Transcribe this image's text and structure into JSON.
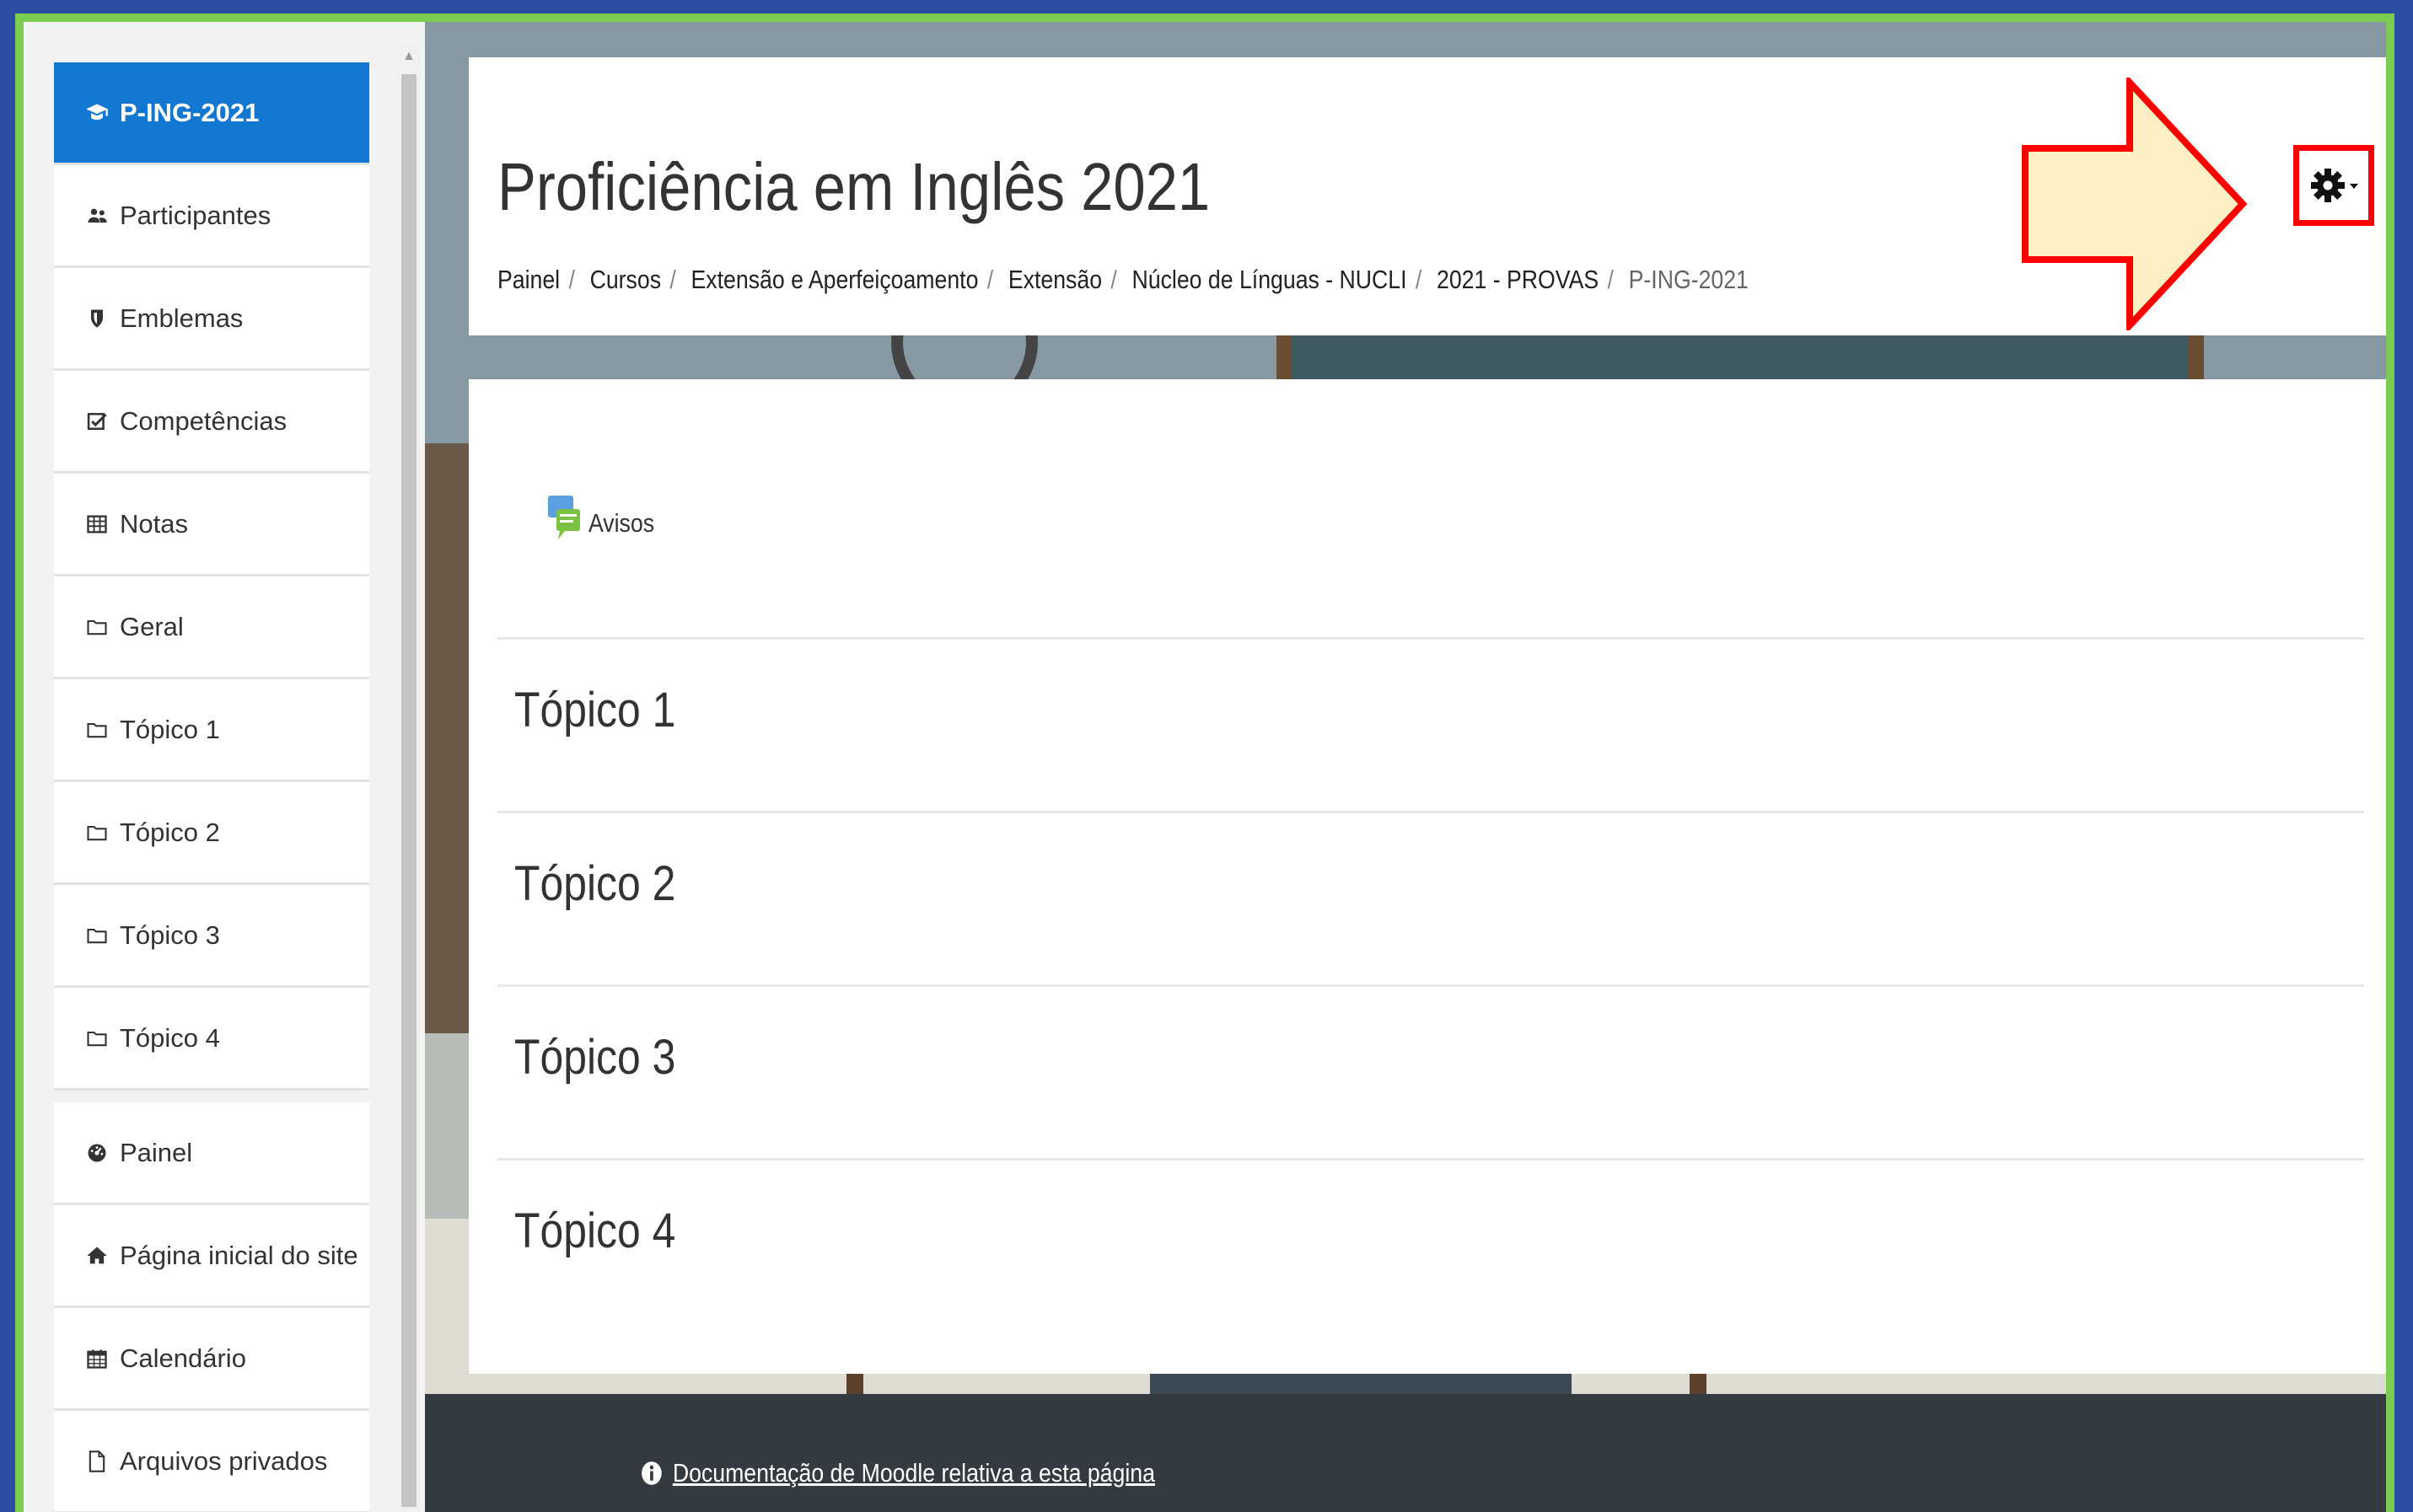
{
  "sidebar": {
    "items": [
      {
        "label": "P-ING-2021",
        "icon": "graduation-cap-icon",
        "active": true
      },
      {
        "label": "Participantes",
        "icon": "users-icon"
      },
      {
        "label": "Emblemas",
        "icon": "shield-icon"
      },
      {
        "label": "Competências",
        "icon": "checkbox-icon"
      },
      {
        "label": "Notas",
        "icon": "table-icon"
      },
      {
        "label": "Geral",
        "icon": "folder-icon"
      },
      {
        "label": "Tópico 1",
        "icon": "folder-icon"
      },
      {
        "label": "Tópico 2",
        "icon": "folder-icon"
      },
      {
        "label": "Tópico 3",
        "icon": "folder-icon"
      },
      {
        "label": "Tópico 4",
        "icon": "folder-icon"
      },
      {
        "label": "Painel",
        "icon": "dashboard-icon"
      },
      {
        "label": "Página inicial do site",
        "icon": "home-icon"
      },
      {
        "label": "Calendário",
        "icon": "calendar-icon"
      },
      {
        "label": "Arquivos privados",
        "icon": "file-icon"
      }
    ]
  },
  "header": {
    "title": "Proficiência em Inglês 2021",
    "breadcrumb": [
      "Painel",
      "Cursos",
      "Extensão e Aperfeiçoamento",
      "Extensão",
      "Núcleo de Línguas - NUCLI",
      "2021 - PROVAS",
      "P-ING-2021"
    ],
    "settings_icon": "gear-icon"
  },
  "content": {
    "avisos_label": "Avisos",
    "sections": [
      "Tópico 1",
      "Tópico 2",
      "Tópico 3",
      "Tópico 4"
    ]
  },
  "footer": {
    "doc_link": "Documentação de Moodle relativa a esta página"
  },
  "colors": {
    "accent": "#1177d1",
    "frame_border": "#7ccb52",
    "outer_background": "#2c4fa3",
    "annotation": "#ff0000",
    "arrow_fill": "#ffefc4",
    "footer": "#343a40"
  }
}
